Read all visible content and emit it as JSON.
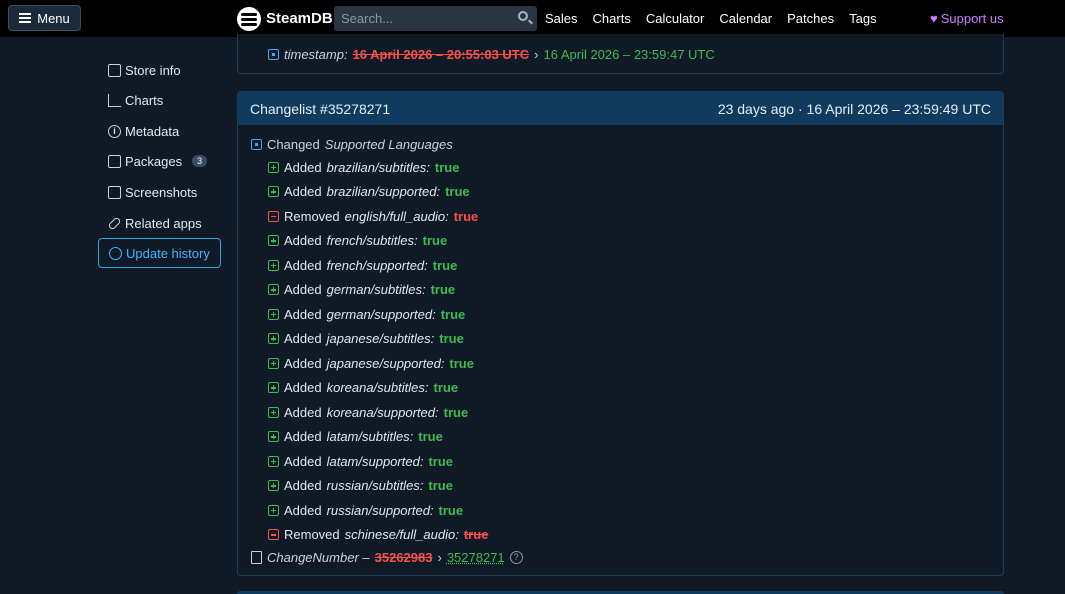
{
  "nav": {
    "menu_label": "Menu",
    "logo_text": "SteamDB",
    "search_placeholder": "Search...",
    "links": [
      "Sales",
      "Charts",
      "Calculator",
      "Calendar",
      "Patches",
      "Tags"
    ],
    "support_label": "Support us"
  },
  "sidebar": {
    "items": [
      {
        "label": "Store info",
        "icon": "store-icon"
      },
      {
        "label": "Charts",
        "icon": "chart-icon"
      },
      {
        "label": "Metadata",
        "icon": "info-icon"
      },
      {
        "label": "Packages",
        "icon": "package-icon",
        "badge": "3"
      },
      {
        "label": "Screenshots",
        "icon": "image-icon"
      },
      {
        "label": "Related apps",
        "icon": "link-icon"
      },
      {
        "label": "Update history",
        "icon": "history-icon",
        "active": true
      }
    ]
  },
  "prev_panel": {
    "key": "timestamp:",
    "old": "16 April 2026 – 20:55:03 UTC",
    "arrow": "›",
    "new": "16 April 2026 – 23:59:47 UTC"
  },
  "changelist": {
    "title": "Changelist #35278271",
    "time": "23 days ago · 16 April 2026 – 23:59:49 UTC",
    "changed_prefix": "Changed",
    "changed_key": "Supported Languages",
    "entries": [
      {
        "action": "Added",
        "key": "brazilian/subtitles:",
        "value": "true"
      },
      {
        "action": "Added",
        "key": "brazilian/supported:",
        "value": "true"
      },
      {
        "action": "Removed",
        "key": "english/full_audio:",
        "value": "true"
      },
      {
        "action": "Added",
        "key": "french/subtitles:",
        "value": "true"
      },
      {
        "action": "Added",
        "key": "french/supported:",
        "value": "true"
      },
      {
        "action": "Added",
        "key": "german/subtitles:",
        "value": "true"
      },
      {
        "action": "Added",
        "key": "german/supported:",
        "value": "true"
      },
      {
        "action": "Added",
        "key": "japanese/subtitles:",
        "value": "true"
      },
      {
        "action": "Added",
        "key": "japanese/supported:",
        "value": "true"
      },
      {
        "action": "Added",
        "key": "koreana/subtitles:",
        "value": "true"
      },
      {
        "action": "Added",
        "key": "koreana/supported:",
        "value": "true"
      },
      {
        "action": "Added",
        "key": "latam/subtitles:",
        "value": "true"
      },
      {
        "action": "Added",
        "key": "latam/supported:",
        "value": "true"
      },
      {
        "action": "Added",
        "key": "russian/subtitles:",
        "value": "true"
      },
      {
        "action": "Added",
        "key": "russian/supported:",
        "value": "true"
      },
      {
        "action": "Removed",
        "key": "schinese/full_audio:",
        "value": "true"
      }
    ],
    "change_number_key": "ChangeNumber –",
    "change_number_old": "35262983",
    "change_number_arrow": "›",
    "change_number_new": "35278271",
    "help_glyph": "?"
  },
  "colors": {
    "added": "#3fb950",
    "removed": "#f85149",
    "accent": "#41b4ff",
    "support": "#c77dff"
  }
}
